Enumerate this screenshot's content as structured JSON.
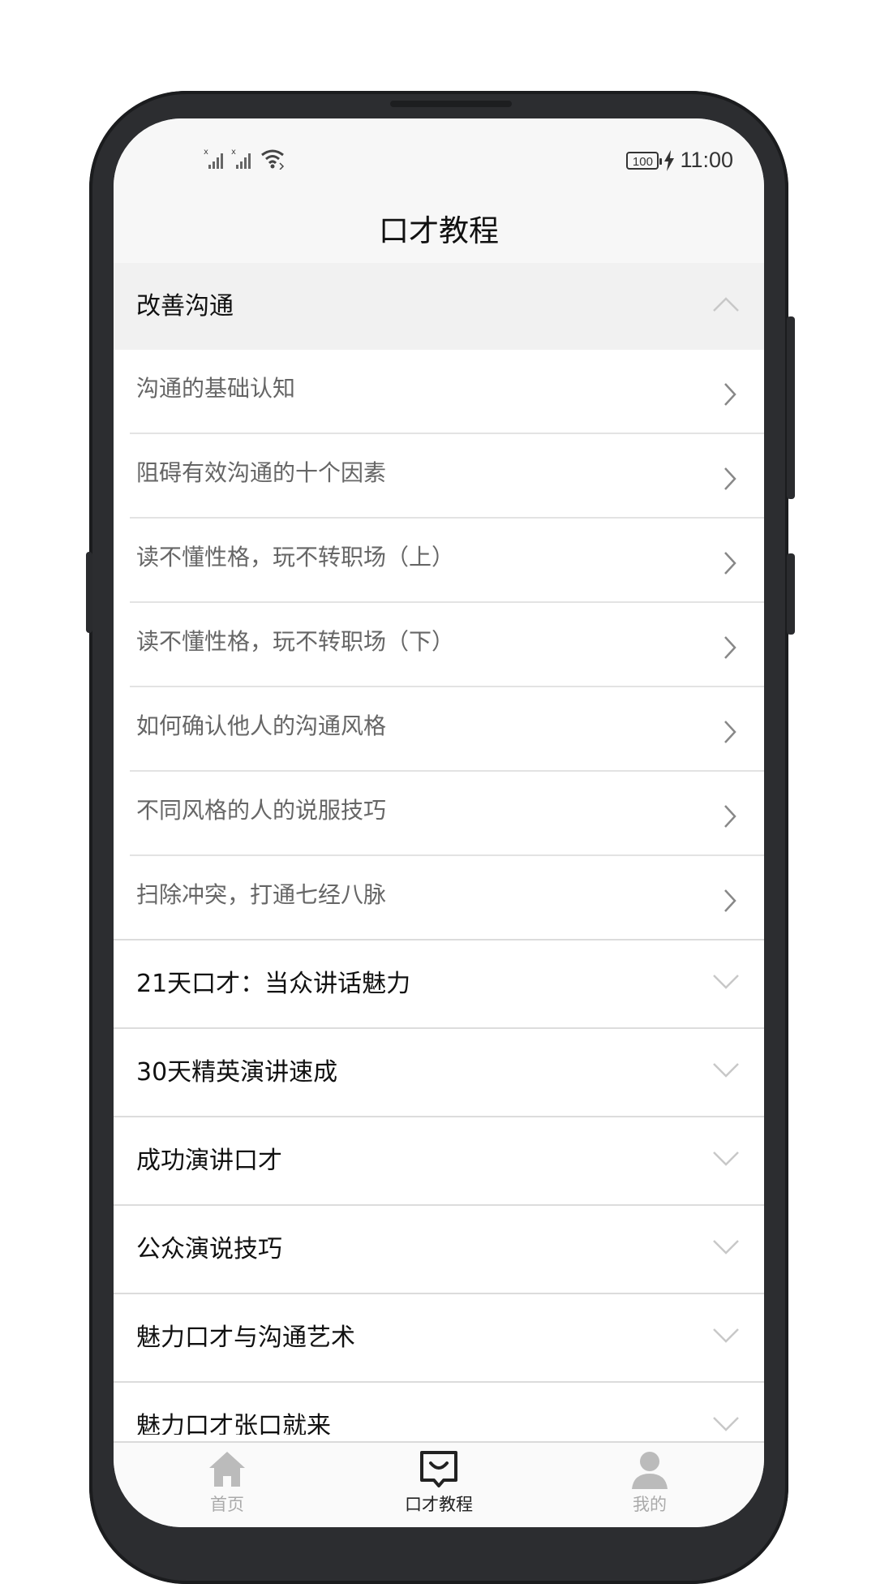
{
  "status_bar": {
    "battery": "100",
    "time": "11:00"
  },
  "header": {
    "title": "口才教程"
  },
  "expanded_group": {
    "title": "改善沟通",
    "items": [
      {
        "label": "沟通的基础认知"
      },
      {
        "label": "阻碍有效沟通的十个因素"
      },
      {
        "label": "读不懂性格，玩不转职场（上）"
      },
      {
        "label": "读不懂性格，玩不转职场（下）"
      },
      {
        "label": "如何确认他人的沟通风格"
      },
      {
        "label": "不同风格的人的说服技巧"
      },
      {
        "label": "扫除冲突，打通七经八脉"
      }
    ]
  },
  "collapsed_groups": [
    {
      "title": "21天口才：当众讲话魅力"
    },
    {
      "title": "30天精英演讲速成"
    },
    {
      "title": "成功演讲口才"
    },
    {
      "title": "公众演说技巧"
    },
    {
      "title": "魅力口才与沟通艺术"
    },
    {
      "title": "魅力口才张口就来"
    }
  ],
  "tabbar": {
    "home": "首页",
    "tutorial": "口才教程",
    "mine": "我的"
  },
  "colors": {
    "active_tab": "#222222",
    "inactive_tab": "#aaaaaa",
    "expanded_bg": "#f1f1f1"
  },
  "icons": {
    "home": "home-icon",
    "tutorial": "chat-smile-icon",
    "mine": "person-icon"
  }
}
